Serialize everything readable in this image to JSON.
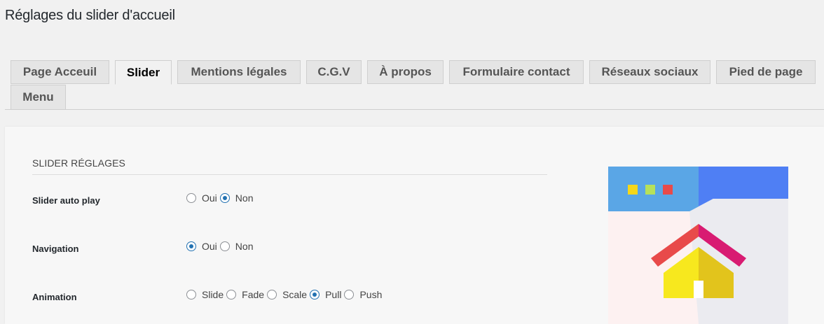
{
  "page": {
    "title": "Réglages du slider d'accueil"
  },
  "tabs": [
    {
      "label": "Page Acceuil",
      "active": false
    },
    {
      "label": "Slider",
      "active": true
    },
    {
      "label": "Mentions légales",
      "active": false
    },
    {
      "label": "C.G.V",
      "active": false
    },
    {
      "label": "À propos",
      "active": false
    },
    {
      "label": "Formulaire contact",
      "active": false
    },
    {
      "label": "Réseaux sociaux",
      "active": false
    },
    {
      "label": "Pied de page",
      "active": false
    },
    {
      "label": "Menu",
      "active": false
    }
  ],
  "section": {
    "title": "SLIDER RÉGLAGES",
    "rows": [
      {
        "label": "Slider auto play",
        "options": [
          "Oui",
          "Non"
        ],
        "selected": "Non"
      },
      {
        "label": "Navigation",
        "options": [
          "Oui",
          "Non"
        ],
        "selected": "Oui"
      },
      {
        "label": "Animation",
        "options": [
          "Slide",
          "Fade",
          "Scale",
          "Pull",
          "Push"
        ],
        "selected": "Pull"
      }
    ]
  },
  "illustration": {
    "icon": "home-page-illustration",
    "colors": {
      "header_left": "#5aa6e6",
      "header_right": "#4f7ff4",
      "dot_yellow": "#f6d71a",
      "dot_green": "#b6e15a",
      "dot_red": "#e84a4a",
      "body_left": "#fdf1f1",
      "body_right": "#ebebf0",
      "roof_left": "#e84a4a",
      "roof_right": "#d81b72",
      "house_left": "#f7e81e",
      "house_right": "#e2c41c",
      "door": "#ffffff"
    }
  }
}
